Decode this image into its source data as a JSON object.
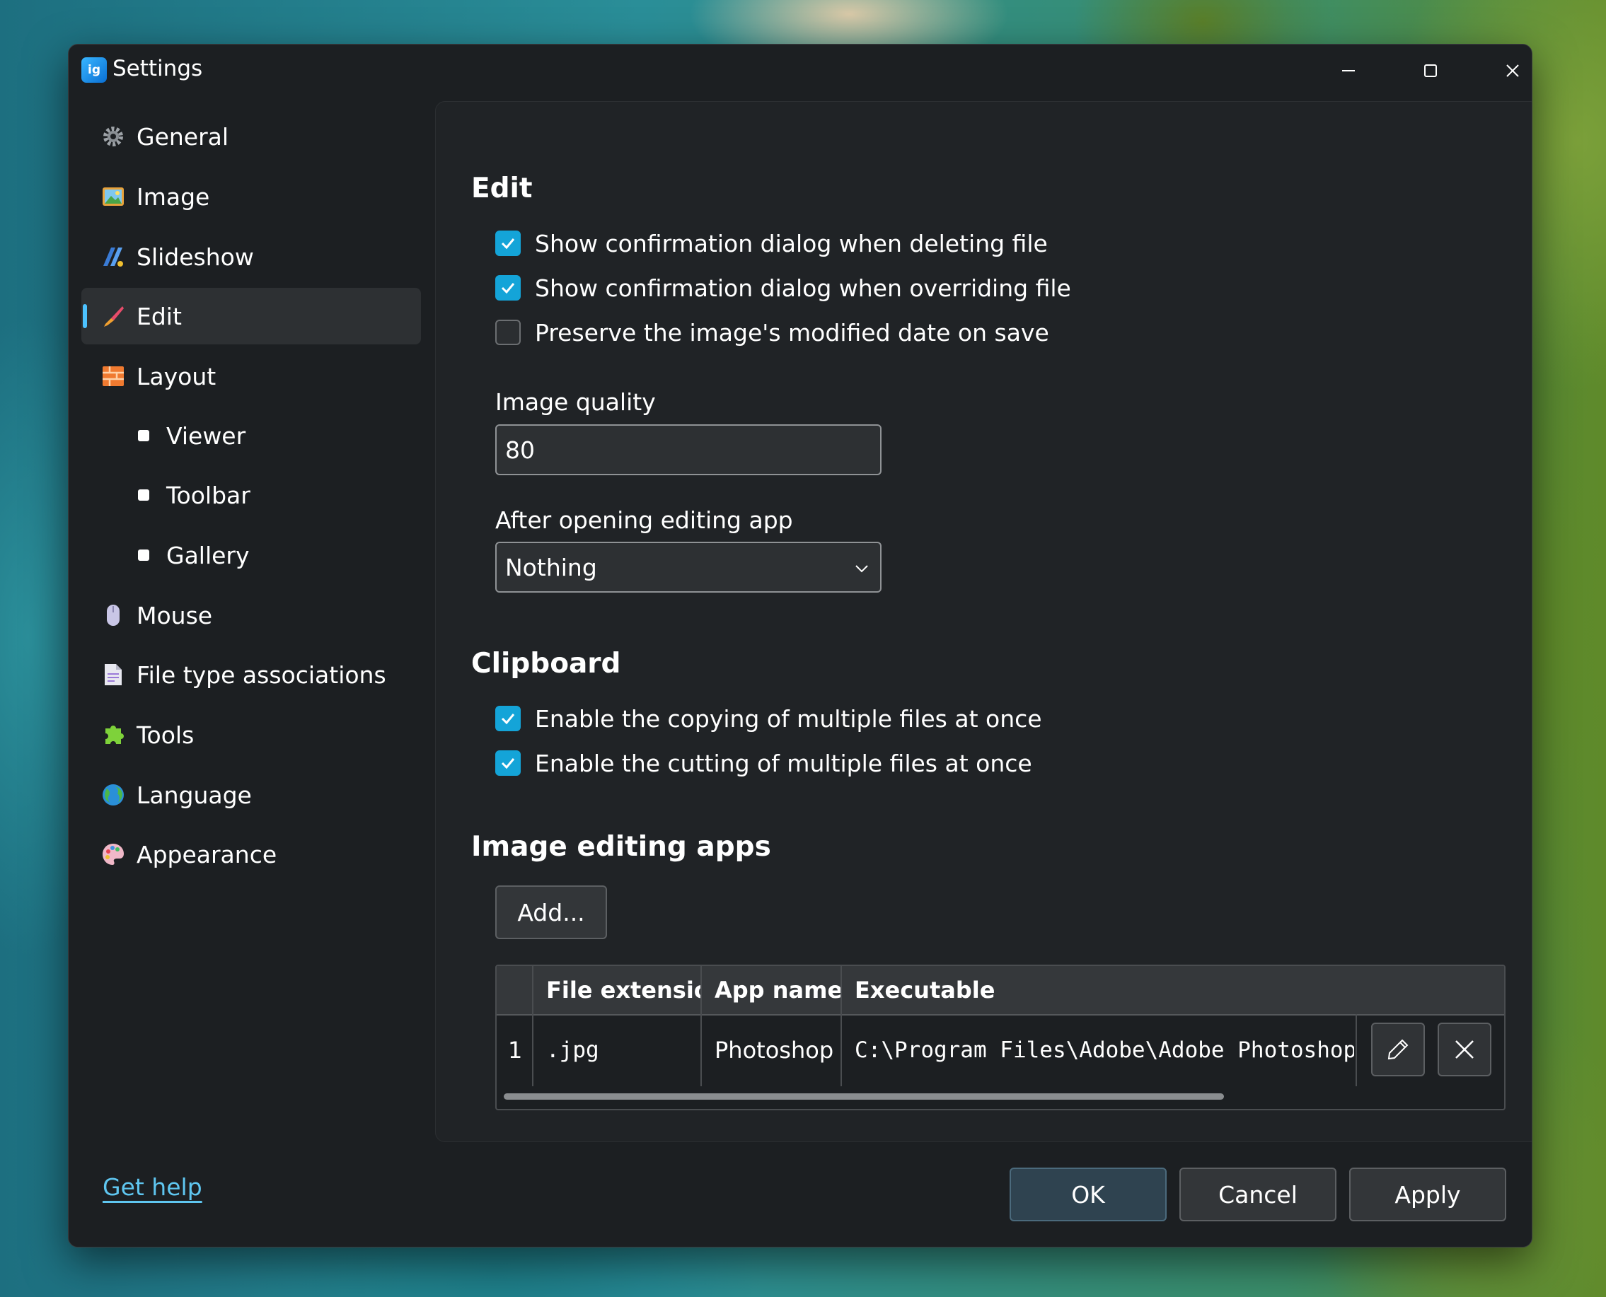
{
  "window": {
    "title": "Settings",
    "app_icon_text": "ig"
  },
  "sidebar": {
    "items": [
      {
        "label": "General",
        "icon": "gear-icon"
      },
      {
        "label": "Image",
        "icon": "picture-icon"
      },
      {
        "label": "Slideshow",
        "icon": "slideshow-icon"
      },
      {
        "label": "Edit",
        "icon": "paintbrush-icon",
        "active": true
      },
      {
        "label": "Layout",
        "icon": "layout-icon"
      },
      {
        "label": "Viewer",
        "sub": true
      },
      {
        "label": "Toolbar",
        "sub": true
      },
      {
        "label": "Gallery",
        "sub": true
      },
      {
        "label": "Mouse",
        "icon": "mouse-icon"
      },
      {
        "label": "File type associations",
        "icon": "document-icon"
      },
      {
        "label": "Tools",
        "icon": "puzzle-icon"
      },
      {
        "label": "Language",
        "icon": "globe-icon"
      },
      {
        "label": "Appearance",
        "icon": "palette-icon"
      }
    ],
    "help_link": "Get help"
  },
  "edit": {
    "title": "Edit",
    "checkboxes": [
      {
        "label": "Show confirmation dialog when deleting file",
        "checked": true
      },
      {
        "label": "Show confirmation dialog when overriding file",
        "checked": true
      },
      {
        "label": "Preserve the image's modified date on save",
        "checked": false
      }
    ],
    "image_quality_label": "Image quality",
    "image_quality_value": "80",
    "after_opening_label": "After opening editing app",
    "after_opening_value": "Nothing"
  },
  "clipboard": {
    "title": "Clipboard",
    "checkboxes": [
      {
        "label": "Enable the copying of multiple files at once",
        "checked": true
      },
      {
        "label": "Enable the cutting of multiple files at once",
        "checked": true
      }
    ]
  },
  "editing_apps": {
    "title": "Image editing apps",
    "add_button": "Add...",
    "columns": [
      "File extension",
      "App name",
      "Executable"
    ],
    "rows": [
      {
        "index": "1",
        "extension": ".jpg",
        "app_name": "Photoshop",
        "executable": "C:\\Program Files\\Adobe\\Adobe Photoshop"
      }
    ]
  },
  "footer": {
    "ok": "OK",
    "cancel": "Cancel",
    "apply": "Apply"
  },
  "colors": {
    "accent": "#14a4d8",
    "link": "#5fc6f0",
    "window_bg": "#1c1f22",
    "panel_bg": "#202326"
  }
}
